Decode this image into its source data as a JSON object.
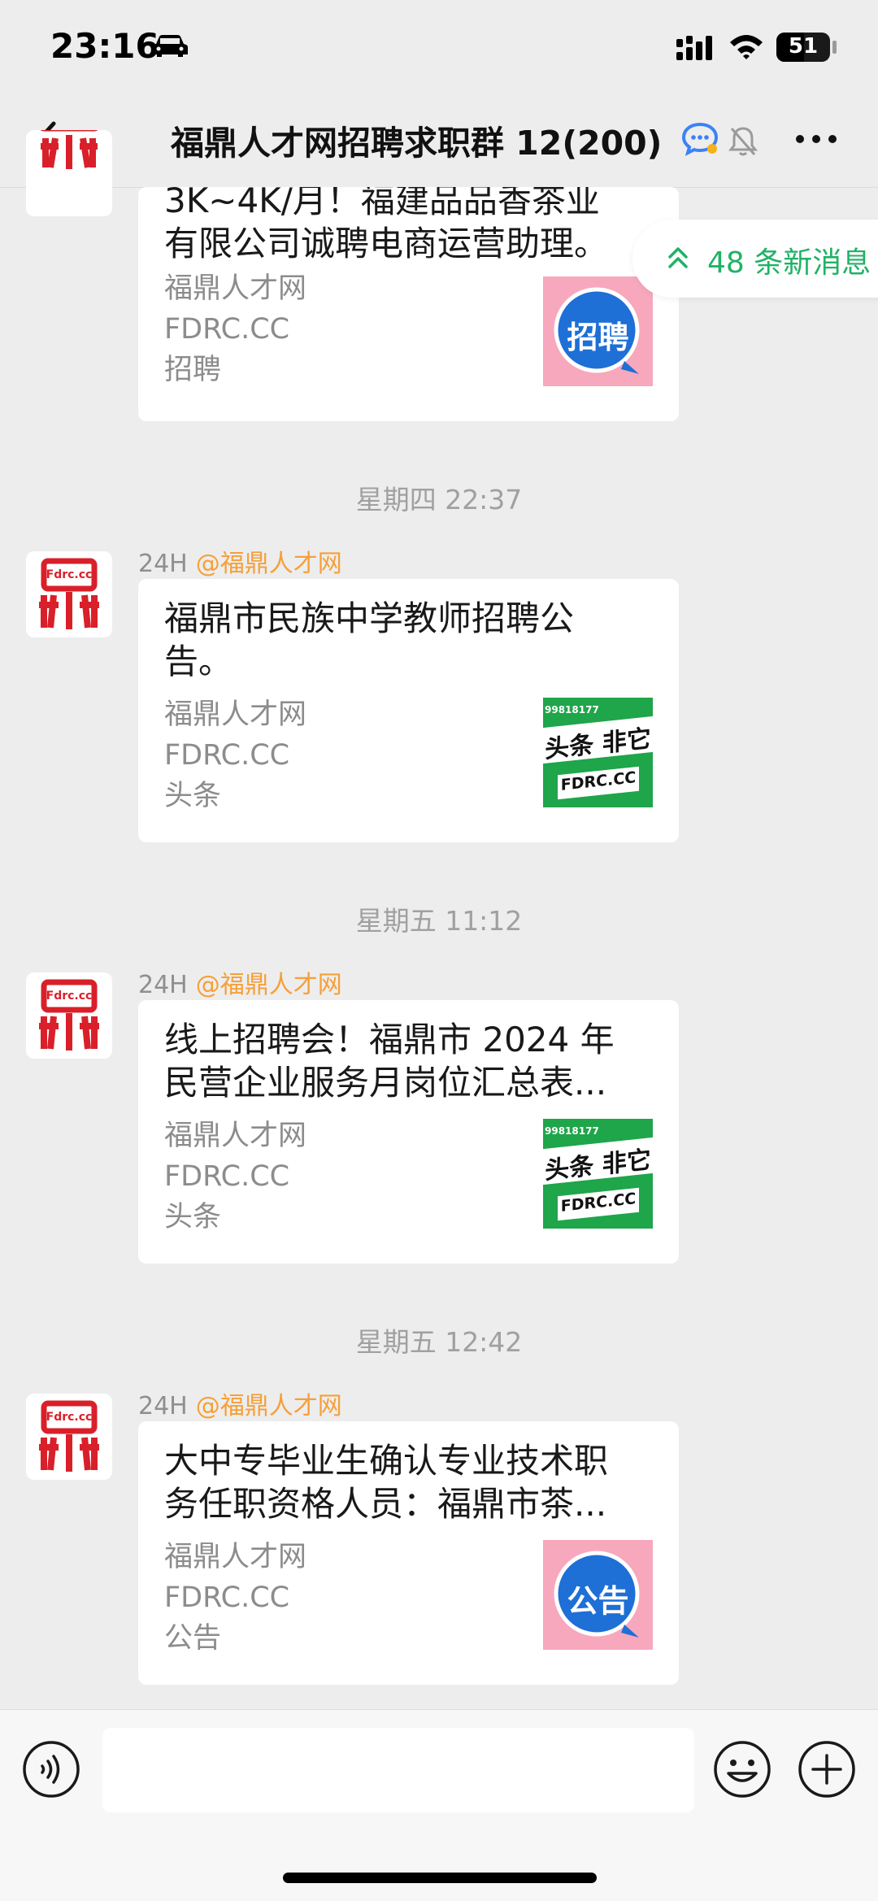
{
  "status_bar": {
    "time": "23:16",
    "battery": "51"
  },
  "nav": {
    "title": "福鼎人才网招聘求职群 12(200)"
  },
  "new_messages": {
    "label": "48 条新消息"
  },
  "messages": [
    {
      "title_lines": [
        "3K~4K/月！福建品品香茶业",
        "有限公司诚聘电商运营助理。"
      ],
      "meta": [
        "福鼎人才网",
        "FDRC.CC",
        "招聘"
      ],
      "thumb_text": "招聘"
    },
    {
      "timestamp": "星期四 22:37",
      "sender_tag": "24H",
      "sender_name": "@福鼎人才网",
      "title_lines": [
        "福鼎市民族中学教师招聘公",
        "告。"
      ],
      "meta": [
        "福鼎人才网",
        "FDRC.CC",
        "头条"
      ],
      "thumb_lines": [
        "99818177",
        "头条 非它",
        "FDRC.CC"
      ]
    },
    {
      "timestamp": "星期五 11:12",
      "sender_tag": "24H",
      "sender_name": "@福鼎人才网",
      "title_lines": [
        "线上招聘会！福鼎市 2024 年",
        "民营企业服务月岗位汇总表..."
      ],
      "meta": [
        "福鼎人才网",
        "FDRC.CC",
        "头条"
      ],
      "thumb_lines": [
        "99818177",
        "头条 非它",
        "FDRC.CC"
      ]
    },
    {
      "timestamp": "星期五 12:42",
      "sender_tag": "24H",
      "sender_name": "@福鼎人才网",
      "title_lines": [
        "大中专毕业生确认专业技术职",
        "务任职资格人员：福鼎市茶..."
      ],
      "meta": [
        "福鼎人才网",
        "FDRC.CC",
        "公告"
      ],
      "thumb_text": "公告"
    }
  ],
  "avatar_logo_text": "Fdrc.cc",
  "colors": {
    "accent_green": "#20b266",
    "mention_orange": "#f5a03a",
    "brand_red": "#d9202a"
  },
  "input": {
    "value": ""
  }
}
